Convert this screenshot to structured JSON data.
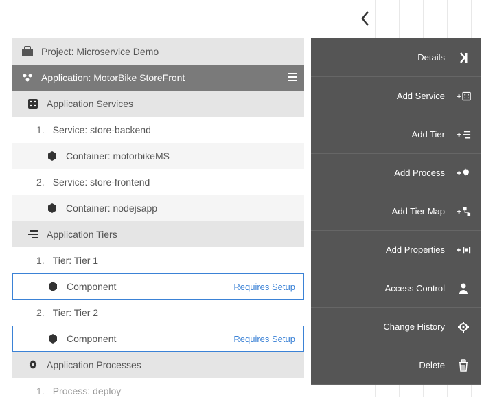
{
  "tree": {
    "project_label": "Project: Microservice Demo",
    "application_label": "Application: MotorBike StoreFront",
    "app_services_label": "Application Services",
    "service1_num": "1.",
    "service1_label": "Service: store-backend",
    "container1_label": "Container: motorbikeMS",
    "service2_num": "2.",
    "service2_label": "Service: store-frontend",
    "container2_label": "Container: nodejsapp",
    "app_tiers_label": "Application Tiers",
    "tier1_num": "1.",
    "tier1_label": "Tier: Tier 1",
    "component1_label": "Component",
    "component1_status": "Requires Setup",
    "tier2_num": "2.",
    "tier2_label": "Tier: Tier 2",
    "component2_label": "Component",
    "component2_status": "Requires Setup",
    "app_processes_label": "Application Processes",
    "process1_num": "1.",
    "process1_label": "Process: deploy"
  },
  "menu": {
    "details": "Details",
    "add_service": "Add Service",
    "add_tier": "Add Tier",
    "add_process": "Add Process",
    "add_tier_map": "Add Tier Map",
    "add_properties": "Add Properties",
    "access_control": "Access Control",
    "change_history": "Change History",
    "delete": "Delete"
  }
}
